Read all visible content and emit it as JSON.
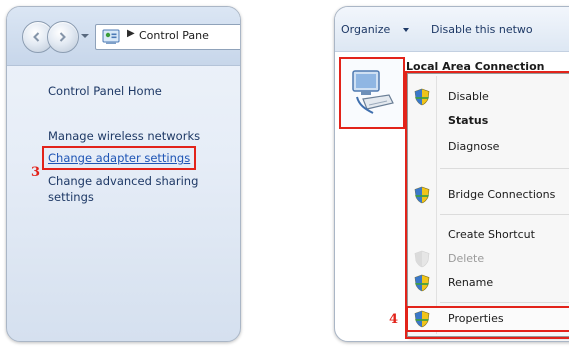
{
  "left_window": {
    "breadcrumb_label": "Control Pane",
    "tasks": {
      "home": "Control Panel Home",
      "manage_wireless": "Manage wireless networks",
      "change_adapter": "Change adapter settings",
      "change_sharing": "Change advanced sharing settings"
    },
    "step_number": "3"
  },
  "right_window": {
    "toolbar": {
      "organize_label": "Organize",
      "disable_label": "Disable this netwo"
    },
    "connection_name": "Local Area Connection",
    "context_menu": [
      {
        "label": "Disable",
        "icon": "shield-icon",
        "style": "normal"
      },
      {
        "label": "Status",
        "icon": "",
        "style": "bold"
      },
      {
        "label": "Diagnose",
        "icon": "",
        "style": "normal"
      },
      {
        "label": "Bridge Connections",
        "icon": "shield-icon",
        "style": "normal"
      },
      {
        "label": "Create Shortcut",
        "icon": "",
        "style": "normal"
      },
      {
        "label": "Delete",
        "icon": "shield-icon",
        "style": "disabled"
      },
      {
        "label": "Rename",
        "icon": "shield-icon",
        "style": "normal"
      },
      {
        "label": "Properties",
        "icon": "shield-icon",
        "style": "normal"
      }
    ],
    "step_number": "4"
  },
  "colors": {
    "highlight": "#e2231a",
    "link": "#1d54b5"
  }
}
